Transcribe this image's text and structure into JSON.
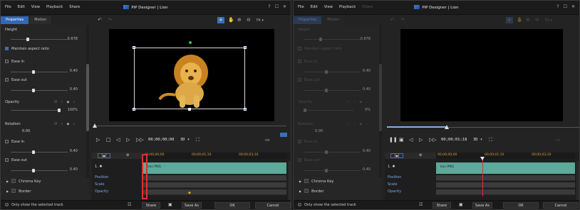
{
  "menu": [
    "File",
    "Edit",
    "View",
    "Playback",
    "Share"
  ],
  "app_title": "PiP Designer | Lion",
  "window_buttons": [
    "?",
    "☐",
    "✕"
  ],
  "tabs": [
    "Properties",
    "Motion"
  ],
  "panel_a": {
    "height_label": "Height",
    "height_value": "0.678",
    "maintain_aspect": "Maintain aspect ratio",
    "ease_in": "Ease in",
    "ease_in_value": "0.40",
    "ease_out": "Ease out",
    "ease_out_value": "0.40",
    "opacity": "Opacity",
    "opacity_value": "100%",
    "rotation": "Rotation",
    "rotation_value": "0.00",
    "ease_in2": "Ease in",
    "ease_in2_value": "0.40",
    "ease_out2": "Ease out",
    "ease_out2_value": "0.40"
  },
  "panel_b": {
    "height_label": "Height",
    "height_value": "0.678",
    "maintain_aspect": "Maintain aspect ratio",
    "ease_in": "Ease in",
    "ease_in_value": "0.40",
    "ease_out": "Ease out",
    "ease_out_value": "0.40",
    "opacity": "Opacity",
    "opacity_value": "0%",
    "rotation": "Rotation",
    "rotation_value": "0.00",
    "ease_in2": "Ease in",
    "ease_in2_value": "0.40",
    "ease_out2": "Ease out",
    "ease_out2_value": "0.40"
  },
  "subpanel": [
    "Chroma Key",
    "Border"
  ],
  "status": {
    "only_selected": "Only show the selected track",
    "share": "Share",
    "save_as": "Save As",
    "ok": "OK",
    "cancel": "Cancel"
  },
  "toolbar": {
    "fit": "Fit"
  },
  "playback_a": {
    "timecode": "00;00;00;00",
    "mode": "3D ▾"
  },
  "playback_b": {
    "timecode": "00;00;01;18",
    "mode": "3D ▾"
  },
  "ruler": [
    "00;00;00;00",
    "00;00;01;10",
    "00;00;03;10"
  ],
  "tracks": {
    "track1": "1.",
    "clip": "lion.PNG",
    "position": "Position",
    "scale": "Scale",
    "opacity": "Opacity"
  },
  "colors": {
    "accent": "#3267b6",
    "clip": "#5da99a",
    "playhead": "#e03030",
    "ruler_text": "#d8a33c"
  }
}
